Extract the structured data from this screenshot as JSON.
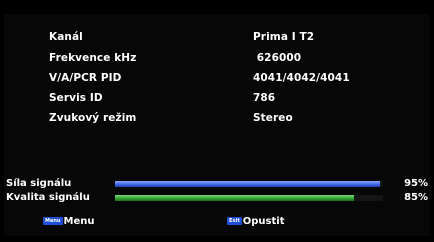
{
  "info": [
    {
      "label": "Kanál",
      "value": "Prima I T2"
    },
    {
      "label": "Frekvence kHz",
      "value": " 626000"
    },
    {
      "label": "V/A/PCR PID",
      "value": "4041/4042/4041"
    },
    {
      "label": "Servis ID",
      "value": "786"
    },
    {
      "label": "Zvukový režim",
      "value": "Stereo"
    }
  ],
  "signal": {
    "strength": {
      "label": "Síla signálu",
      "percent_text": "95%",
      "level": 0.99
    },
    "quality": {
      "label": "Kvalita signálu",
      "percent_text": "85%",
      "level": 0.89
    }
  },
  "footer": {
    "menu_key": "Menu",
    "menu_label": "Menu",
    "exit_key": "Exit",
    "exit_label": "Opustit"
  },
  "colors": {
    "strength_bar": "#3e63e8",
    "quality_bar": "#2fa02f",
    "key_badge": "#1f4fd6"
  }
}
